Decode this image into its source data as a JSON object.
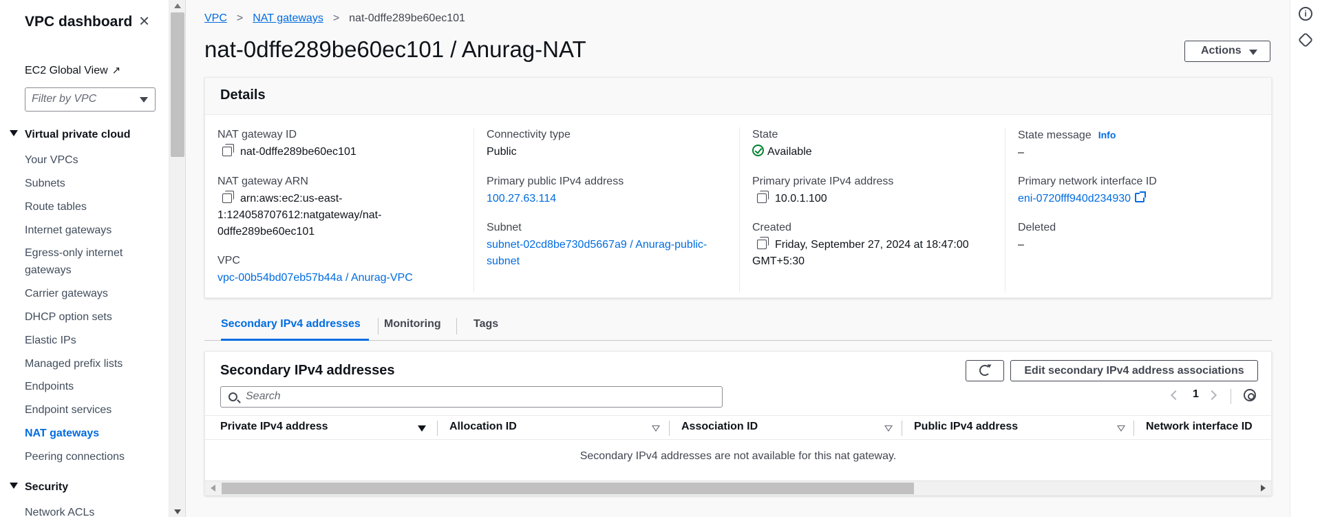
{
  "sidebar": {
    "title": "VPC dashboard",
    "ec2_global_view": "EC2 Global View",
    "filter_placeholder": "Filter by VPC",
    "section_vpc": "Virtual private cloud",
    "items": [
      "Your VPCs",
      "Subnets",
      "Route tables",
      "Internet gateways",
      "Egress-only internet gateways",
      "Carrier gateways",
      "DHCP option sets",
      "Elastic IPs",
      "Managed prefix lists",
      "Endpoints",
      "Endpoint services",
      "NAT gateways",
      "Peering connections"
    ],
    "active_item": "NAT gateways",
    "section_security": "Security",
    "security_items": [
      "Network ACLs"
    ]
  },
  "breadcrumb": {
    "vpc": "VPC",
    "nat": "NAT gateways",
    "current": "nat-0dffe289be60ec101"
  },
  "page_title": "nat-0dffe289be60ec101 / Anurag-NAT",
  "actions_label": "Actions",
  "details": {
    "header": "Details",
    "nat_gateway_id_label": "NAT gateway ID",
    "nat_gateway_id": "nat-0dffe289be60ec101",
    "nat_gateway_arn_label": "NAT gateway ARN",
    "nat_gateway_arn_line1": "arn:aws:ec2:us-east-",
    "nat_gateway_arn_line2": "1:124058707612:natgateway/nat-",
    "nat_gateway_arn_line3": "0dffe289be60ec101",
    "vpc_label": "VPC",
    "vpc": "vpc-00b54bd07eb57b44a / Anurag-VPC",
    "connectivity_label": "Connectivity type",
    "connectivity": "Public",
    "public_ip_label": "Primary public IPv4 address",
    "public_ip": "100.27.63.114",
    "subnet_label": "Subnet",
    "subnet_line1": "subnet-02cd8be730d5667a9 / Anurag-public-",
    "subnet_line2": "subnet",
    "state_label": "State",
    "state": "Available",
    "private_ip_label": "Primary private IPv4 address",
    "private_ip": "10.0.1.100",
    "created_label": "Created",
    "created_line1": "Friday, September 27, 2024 at 18:47:00",
    "created_line2": "GMT+5:30",
    "state_message_label": "State message",
    "info": "Info",
    "state_message": "–",
    "eni_label": "Primary network interface ID",
    "eni": "eni-0720fff940d234930",
    "deleted_label": "Deleted",
    "deleted": "–"
  },
  "tabs": [
    "Secondary IPv4 addresses",
    "Monitoring",
    "Tags"
  ],
  "secondary": {
    "title": "Secondary IPv4 addresses",
    "edit_button": "Edit secondary IPv4 address associations",
    "search_placeholder": "Search",
    "page": "1",
    "columns": [
      "Private IPv4 address",
      "Allocation ID",
      "Association ID",
      "Public IPv4 address",
      "Network interface ID"
    ],
    "empty": "Secondary IPv4 addresses are not available for this nat gateway."
  },
  "colors": {
    "link": "#006ce0",
    "success": "#00802f",
    "text": "#0f141a"
  }
}
